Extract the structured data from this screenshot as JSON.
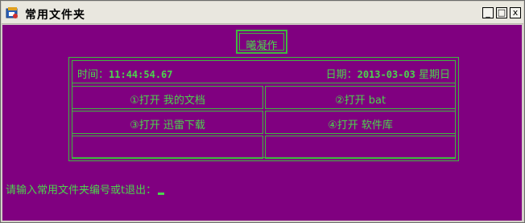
{
  "window": {
    "title": "常用文件夹",
    "minimize_label": "_",
    "maximize_label": "□",
    "close_label": "x"
  },
  "console": {
    "heading": "曦凝作",
    "time_label": "时间：",
    "time_value": "11:44:54.67",
    "date_label": "日期：",
    "date_value": "2013-03-03",
    "weekday": "星期日",
    "menu": [
      {
        "label": "①打开 我的文档"
      },
      {
        "label": "②打开 bat"
      },
      {
        "label": "③打开 迅雷下载"
      },
      {
        "label": "④打开 软件库"
      },
      {
        "label": ""
      },
      {
        "label": ""
      }
    ],
    "prompt": "请输入常用文件夹编号或t退出："
  },
  "colors": {
    "console_bg": "#800080",
    "console_text": "#4cd44c",
    "titlebar_bg": "#e9e7df"
  }
}
